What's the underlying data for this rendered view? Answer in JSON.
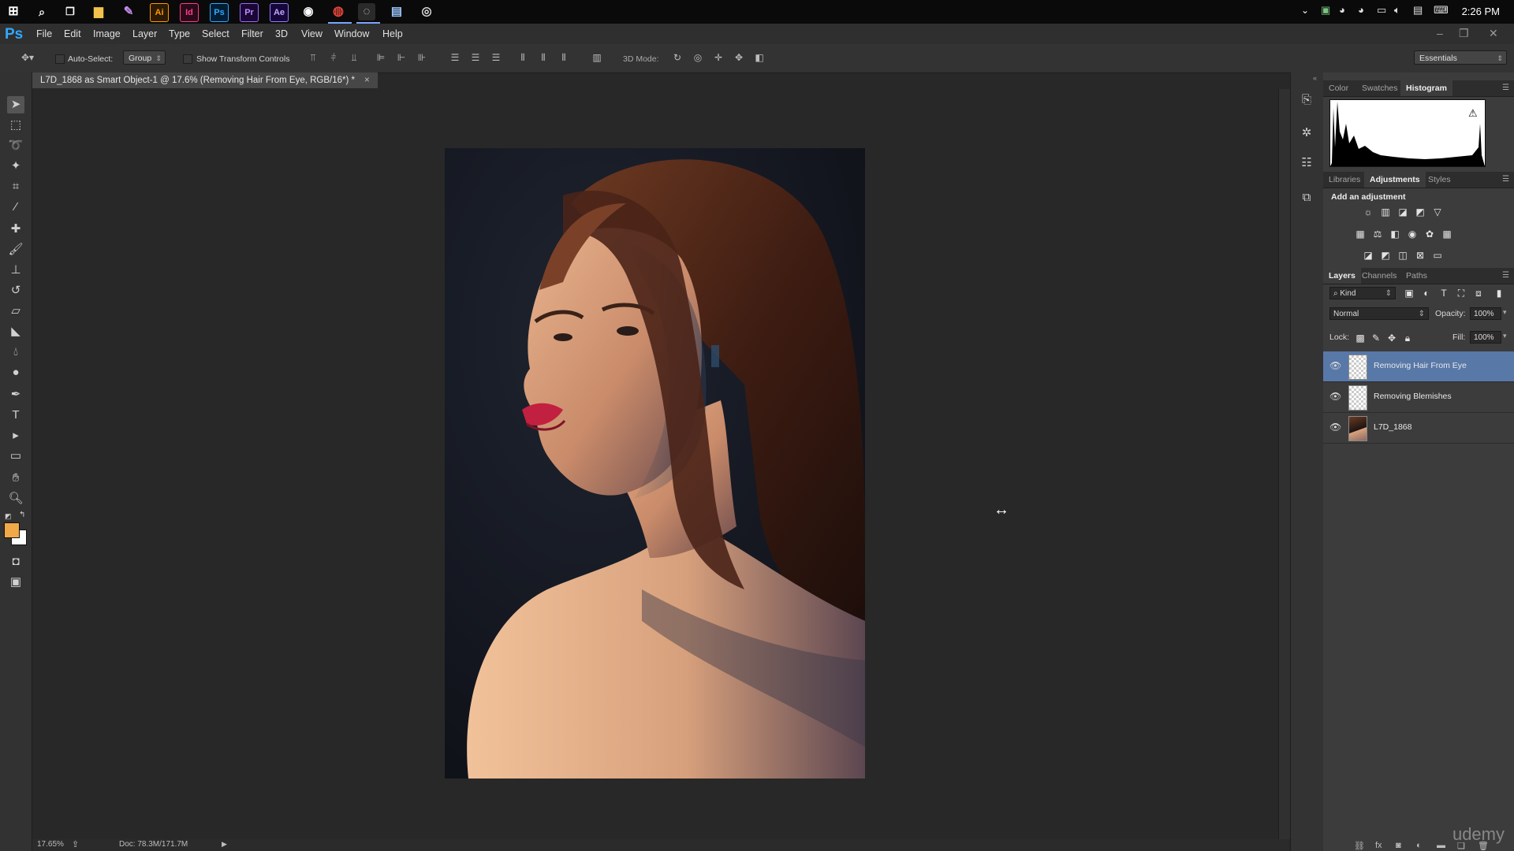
{
  "taskbar": {
    "app_icons": [
      "start-icon",
      "search-icon",
      "task-view-icon",
      "file-explorer-icon",
      "pen-app-icon",
      "illustrator-icon",
      "indesign-icon",
      "photoshop-icon",
      "premiere-icon",
      "after-effects-icon",
      "app-icon",
      "chrome-icon",
      "app-icon",
      "app-icon",
      "app-icon"
    ],
    "illustrator_label": "Ai",
    "indesign_label": "Id",
    "photoshop_label": "Ps",
    "premiere_label": "Pr",
    "aftereffects_label": "Ae",
    "clock": "2:26 PM"
  },
  "menubar": {
    "logo": "Ps",
    "items": [
      "File",
      "Edit",
      "Image",
      "Layer",
      "Type",
      "Select",
      "Filter",
      "3D",
      "View",
      "Window",
      "Help"
    ]
  },
  "options": {
    "auto_select_label": "Auto-Select:",
    "auto_select_value": "Group",
    "show_transform_label": "Show Transform Controls",
    "mode_3d_label": "3D Mode:",
    "workspace": "Essentials"
  },
  "document": {
    "tab_title": "L7D_1868 as Smart Object-1 @ 17.6% (Removing Hair From Eye, RGB/16*) *",
    "zoom": "17.65%",
    "doc_size": "Doc: 78.3M/171.7M"
  },
  "panels": {
    "top_tabs": [
      "Color",
      "Swatches",
      "Histogram"
    ],
    "top_active": "Histogram",
    "mid_tabs": [
      "Libraries",
      "Adjustments",
      "Styles"
    ],
    "mid_active": "Adjustments",
    "adjust_title": "Add an adjustment",
    "layer_tabs": [
      "Layers",
      "Channels",
      "Paths"
    ],
    "layer_active": "Layers",
    "filter_kind": "Kind",
    "blend_mode": "Normal",
    "opacity_label": "Opacity:",
    "opacity_value": "100%",
    "lock_label": "Lock:",
    "fill_label": "Fill:",
    "fill_value": "100%",
    "layers": [
      {
        "name": "Removing Hair From Eye",
        "selected": true
      },
      {
        "name": "Removing Blemishes",
        "selected": false
      },
      {
        "name": "L7D_1868",
        "selected": false
      }
    ]
  },
  "watermark": "udemy",
  "colors": {
    "foreground": "#f0a848",
    "background": "#ffffff",
    "selection": "#5878a8",
    "ps_blue": "#31a8ff"
  }
}
